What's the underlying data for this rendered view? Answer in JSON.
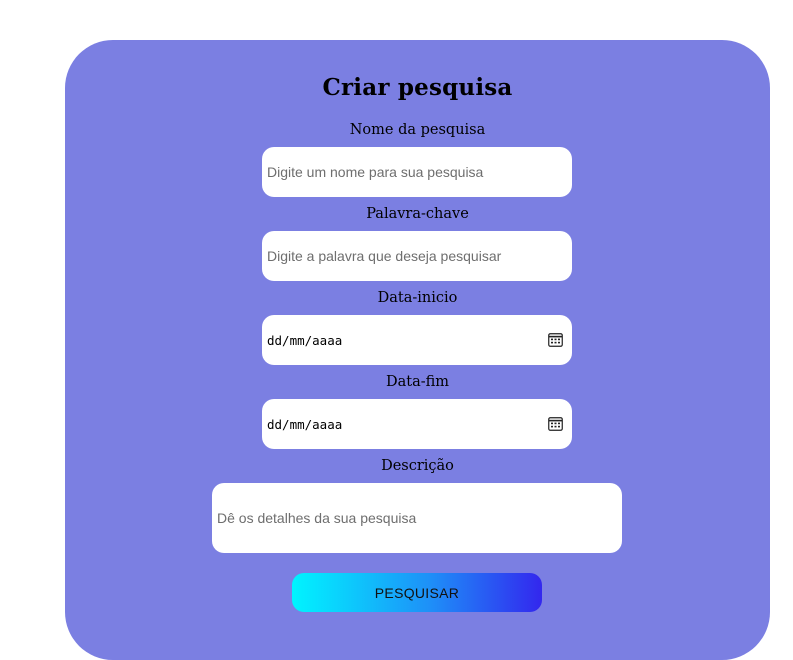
{
  "form": {
    "title": "Criar pesquisa",
    "fields": [
      {
        "label": "Nome da pesquisa",
        "placeholder": "Digite um nome para sua pesquisa",
        "value": ""
      },
      {
        "label": "Palavra-chave",
        "placeholder": "Digite a palavra que deseja pesquisar",
        "value": ""
      },
      {
        "label": "Data-inicio",
        "display": "dd/mm/aaaa",
        "icon": "calendar-icon"
      },
      {
        "label": "Data-fim",
        "display": "dd/mm/aaaa",
        "icon": "calendar-icon"
      },
      {
        "label": "Descrição",
        "placeholder": "Dê os detalhes da sua pesquisa",
        "value": ""
      }
    ],
    "submit_label": "PESQUISAR"
  },
  "colors": {
    "page_background": "#ffffff",
    "card_background": "#7b7fe2",
    "field_background": "#ffffff",
    "button_gradient_start": "#00f4ff",
    "button_gradient_end": "#3327ee"
  }
}
